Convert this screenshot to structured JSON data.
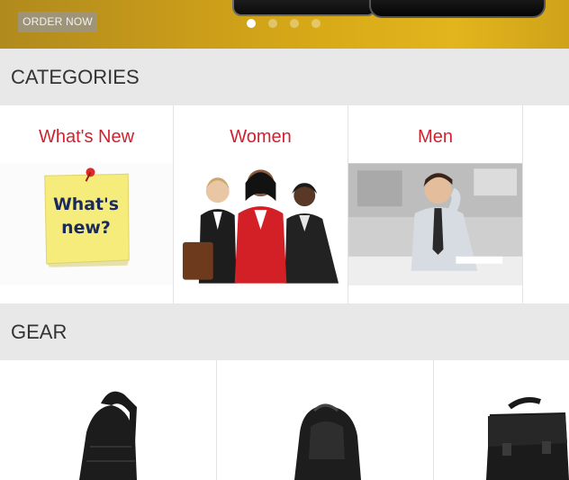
{
  "hero": {
    "order_label": "ORDER NOW",
    "slide_count": 4,
    "active_slide": 1
  },
  "categories": {
    "title": "CATEGORIES",
    "items": [
      {
        "label": "What's New",
        "image": "whats-new-sticky-note"
      },
      {
        "label": "Women",
        "image": "women-group-photo"
      },
      {
        "label": "Men",
        "image": "man-at-desk-photo"
      }
    ],
    "note_text_line1": "What's",
    "note_text_line2": "new?"
  },
  "gear": {
    "title": "GEAR",
    "items": [
      {
        "image": "sling-bag"
      },
      {
        "image": "backpack"
      },
      {
        "image": "messenger-bag"
      }
    ]
  },
  "colors": {
    "accent": "#d0222e",
    "section_bg": "#e8e8e8",
    "hero_gold": "#d7a918"
  }
}
